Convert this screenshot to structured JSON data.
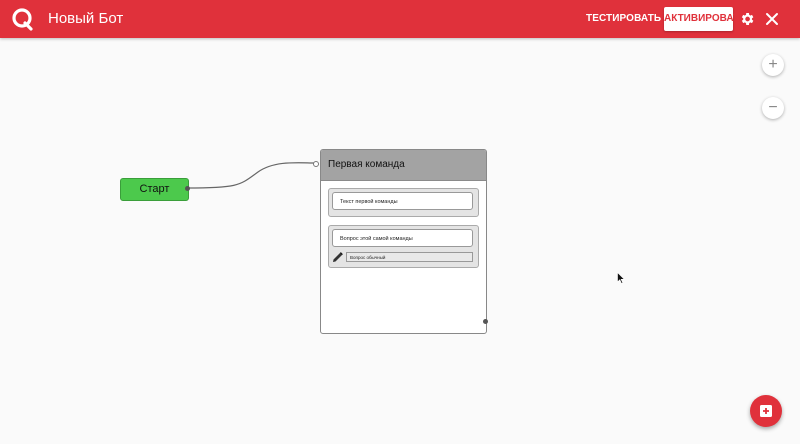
{
  "header": {
    "title": "Новый Бот",
    "test_label": "ТЕСТИРОВАТЬ",
    "activate_label": "АКТИВИРОВАТЬ",
    "icons": [
      "logo-icon",
      "gear-icon",
      "close-icon"
    ]
  },
  "colors": {
    "brand": "#e0313b",
    "start_node": "#4cc94c",
    "command_header": "#a3a3a3"
  },
  "canvas": {
    "zoom_in_label": "+",
    "zoom_out_label": "−",
    "start_node": {
      "label": "Старт"
    },
    "command_node": {
      "title": "Первая команда",
      "text_block": "Текст первой команды",
      "question_block": "Вопрос этой самой команды",
      "question_type": "Вопрос обычный"
    },
    "add_button_icon": "add-square-icon"
  }
}
